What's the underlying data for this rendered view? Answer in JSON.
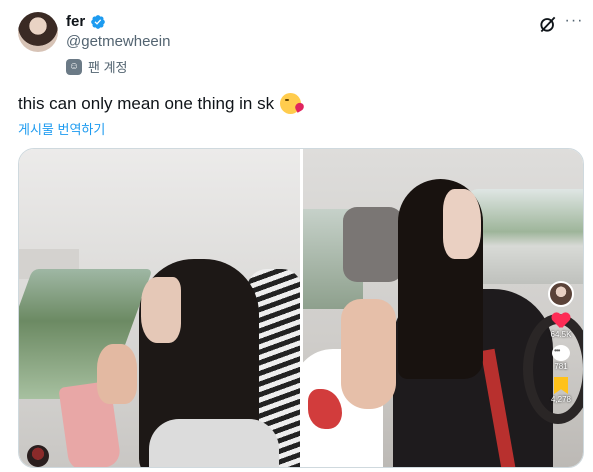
{
  "author": {
    "display_name": "fer",
    "handle": "@getmewheein",
    "fan_label": "팬 계정"
  },
  "tweet": {
    "text": "this can only mean one thing in sk",
    "translate_label": "게시물 번역하기"
  },
  "media": {
    "overlay": {
      "likes": "64.5K",
      "comments": "781",
      "bookmarks": "4,278"
    }
  },
  "colors": {
    "accent": "#1d9bf0",
    "muted": "#536471",
    "like": "#fe2c55",
    "bookmark": "#ffc21a"
  },
  "icons": [
    "verified-badge-icon",
    "grok-icon",
    "more-icon",
    "fan-account-mask-icon",
    "kiss-emoji-icon",
    "heart-icon",
    "comment-icon",
    "bookmark-icon"
  ]
}
